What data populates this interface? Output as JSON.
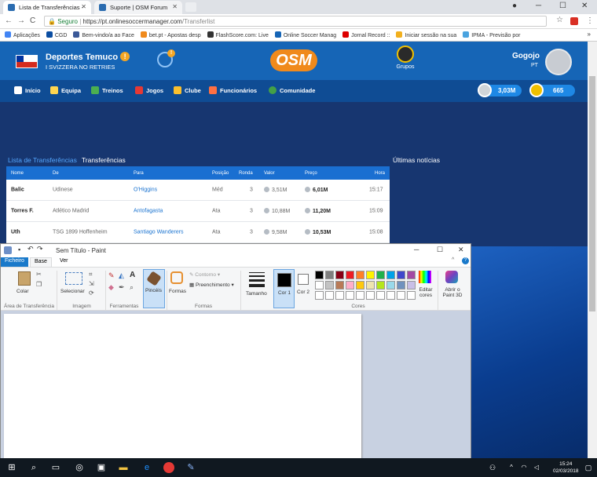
{
  "browser": {
    "tabs": [
      {
        "title": "Lista de Transferências -"
      },
      {
        "title": "Suporte | OSM Forum"
      }
    ],
    "url_secure": "Seguro",
    "url_host": "https://pt.onlinesoccermanager.com",
    "url_path": "/Transferlist",
    "bookmarks": [
      "Aplicações",
      "CGD",
      "Bem-vindo/a ao Face",
      "bet.pt - Apostas desp",
      "FlashScore.com: Live",
      "Online Soccer Manag",
      "Jornal Record :: ",
      "Iniciar sessão na sua",
      "IPMA - Previsão por"
    ],
    "bookmarks_more": "»"
  },
  "osm": {
    "team_name": "Deportes Temuco",
    "league": "I SVIZZERA NO RETRIES",
    "logo": "OSM",
    "groups_label": "Grupos",
    "manager_name": "Gogojo",
    "manager_country": "PT",
    "nav": [
      "Início",
      "Equipa",
      "Treinos",
      "Jogos",
      "Clube",
      "Funcionários",
      "Comunidade"
    ],
    "money": "3,03M",
    "credits": "665",
    "section_link": "Lista de Transferências",
    "section_current": "Transferências",
    "news_title": "Últimas notícias",
    "table": {
      "headers": [
        "Nome",
        "De",
        "Para",
        "Posição",
        "Ronda",
        "Valor",
        "Preço",
        "Hora"
      ],
      "rows": [
        [
          "Balic",
          "Udinese",
          "O'Higgins",
          "Méd",
          "3",
          "3,51M",
          "6,01M",
          "15:17"
        ],
        [
          "Torres F.",
          "Atlético Madrid",
          "Antofagasta",
          "Ata",
          "3",
          "10,88M",
          "11,20M",
          "15:09"
        ],
        [
          "Uth",
          "TSG 1899 Hoffenheim",
          "Santiago Wanderers",
          "Ata",
          "3",
          "9,58M",
          "10,53M",
          "15:08"
        ]
      ]
    }
  },
  "paint": {
    "title": "Sem Título - Paint",
    "tabs": [
      "Ficheiro",
      "Base",
      "Ver"
    ],
    "paste": "Colar",
    "select": "Selecionar",
    "brushes": "Pincéis",
    "shapes": "Formas",
    "outline": "Contorno",
    "fill": "Preenchimento",
    "size": "Tamanho",
    "color1": "Cor 1",
    "color2": "Cor 2",
    "edit_colors": "Editar cores",
    "paint3d": "Abrir o Paint 3D",
    "groups": [
      "Área de Transferência",
      "Imagem",
      "Ferramentas",
      "Formas",
      "Cores"
    ],
    "palette": [
      "#000000",
      "#7f7f7f",
      "#880015",
      "#ed1c24",
      "#ff7f27",
      "#fff200",
      "#22b14c",
      "#00a2e8",
      "#3f48cc",
      "#a349a4",
      "#ffffff",
      "#c3c3c3",
      "#b97a57",
      "#ffaec9",
      "#ffc90e",
      "#efe4b0",
      "#b5e61d",
      "#99d9ea",
      "#7092be",
      "#c8bfe7"
    ]
  },
  "taskbar": {
    "time": "15:24",
    "date": "02/03/2018"
  }
}
